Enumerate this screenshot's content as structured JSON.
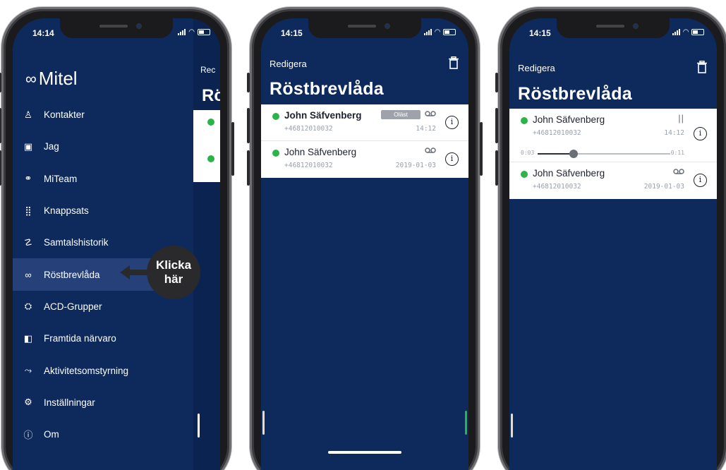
{
  "phone1": {
    "time": "14:14",
    "logo": "Mitel",
    "logo_mark": "∞",
    "menu": [
      {
        "label": "Kontakter",
        "icon": "contacts-icon",
        "glyph": "♙"
      },
      {
        "label": "Jag",
        "icon": "profile-card-icon",
        "glyph": "▣"
      },
      {
        "label": "MiTeam",
        "icon": "team-icon",
        "glyph": "⚭"
      },
      {
        "label": "Knappsats",
        "icon": "keypad-icon",
        "glyph": "⣿"
      },
      {
        "label": "Samtalshistorik",
        "icon": "call-history-icon",
        "glyph": "☡"
      },
      {
        "label": "Röstbrevlåda",
        "icon": "voicemail-icon",
        "glyph": "∞",
        "active": true
      },
      {
        "label": "ACD-Grupper",
        "icon": "acd-groups-icon",
        "glyph": "⛭"
      },
      {
        "label": "Framtida närvaro",
        "icon": "calendar-icon",
        "glyph": "◧"
      },
      {
        "label": "Aktivitetsomstyrning",
        "icon": "redirect-icon",
        "glyph": "⤳"
      },
      {
        "label": "Inställningar",
        "icon": "settings-gear-icon",
        "glyph": "⚙"
      },
      {
        "label": "Om",
        "icon": "about-info-icon",
        "glyph": "ⓘ"
      }
    ],
    "peek_edit": "Rec",
    "peek_title": "Rö",
    "callout": {
      "line1": "Klicka",
      "line2": "här"
    }
  },
  "phone2": {
    "time": "14:15",
    "edit": "Redigera",
    "title": "Röstbrevlåda",
    "rows": [
      {
        "name": "John Säfvenberg",
        "number": "+46812010032",
        "time": "14:12",
        "badge": "Oläst",
        "unread": true
      },
      {
        "name": "John Säfvenberg",
        "number": "+46812010032",
        "time": "2019-01-03"
      }
    ]
  },
  "phone3": {
    "time": "14:15",
    "edit": "Redigera",
    "title": "Röstbrevlåda",
    "rows": [
      {
        "name": "John Säfvenberg",
        "number": "+46812010032",
        "time": "14:12",
        "pause": "||"
      },
      {
        "name": "John Säfvenberg",
        "number": "+46812010032",
        "time": "2019-01-03"
      }
    ],
    "player": {
      "elapsed": "0:03",
      "duration": "0:11",
      "progress": 0.27
    }
  },
  "colors": {
    "app_bg": "#0e2a5c",
    "active_item": "#26407a",
    "presence_green": "#2cb34a",
    "callout": "#2a2a2c"
  }
}
